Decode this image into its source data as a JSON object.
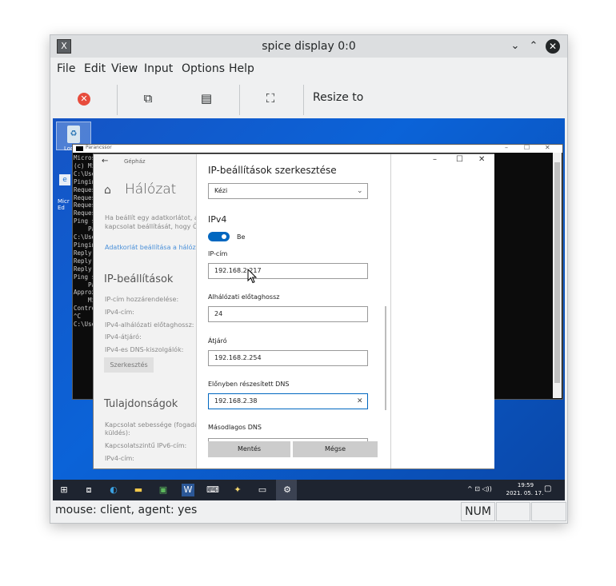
{
  "window": {
    "title": "spice display 0:0",
    "app_icon": "X"
  },
  "titlebar_controls": {
    "minimize": "⌄",
    "maximize": "⌃",
    "close": "✕"
  },
  "menubar": {
    "items": [
      "File",
      "Edit",
      "View",
      "Input",
      "Options",
      "Help"
    ]
  },
  "toolbar": {
    "resize_label": "Resize to"
  },
  "statusbar": {
    "text": "mouse: client, agent: yes",
    "num": "NUM"
  },
  "desktop": {
    "recycle_label": "Lom",
    "edge_label": "Micr\nEd"
  },
  "cmd": {
    "title": "Parancssor",
    "lines": [
      "Micros",
      "(c) Mi",
      "",
      "C:\\Use",
      "",
      "Pingin",
      "Reques",
      "Reques",
      "Reques",
      "Reques",
      "",
      "Ping s",
      "    Pa",
      "",
      "C:\\Use",
      "",
      "Pingin",
      "Reply",
      "Reply",
      "Reply",
      "",
      "Ping s",
      "    Pa",
      "Approx",
      "    Mi",
      "Contro",
      "^C",
      "C:\\Use"
    ]
  },
  "settings": {
    "breadcrumb": "Gépház",
    "heading": "Hálózat",
    "desc_line1": "Ha beállít egy adatkorlátot, a",
    "desc_line2": "kapcsolat beállítását, hogy Ön",
    "link": "Adatkorlát beállítása a hálóza",
    "ip_heading": "IP-beállítások",
    "ip_rows": [
      "IP-cím hozzárendelése:",
      "IPv4-cím:",
      "IPv4-alhálózati előtaghossz:",
      "IPv4-átjáró:",
      "IPv4-es DNS-kiszolgálók:"
    ],
    "edit_button": "Szerkesztés",
    "props_heading": "Tulajdonságok",
    "props_rows": [
      "Kapcsolat sebessége (fogadás",
      "küldés):",
      "Kapcsolatszintű IPv6-cím:",
      "IPv4-cím:"
    ]
  },
  "dialog": {
    "title": "IP-beállítások szerkesztése",
    "mode_value": "Kézi",
    "ipv4_heading": "IPv4",
    "toggle_label": "Be",
    "toggle_on": true,
    "ip_label": "IP-cím",
    "ip_value": "192.168.2.217",
    "prefix_label": "Alhálózati előtaghossz",
    "prefix_value": "24",
    "gateway_label": "Átjáró",
    "gateway_value": "192.168.2.254",
    "dns1_label": "Előnyben részesített DNS",
    "dns1_value": "192.168.2.38",
    "dns2_label": "Másodlagos DNS",
    "save_button": "Mentés",
    "cancel_button": "Mégse"
  },
  "taskbar": {
    "time": "19:59",
    "date": "2021. 05. 17.",
    "tray": "^ ⊡ ◁))"
  },
  "colors": {
    "accent": "#0067c0",
    "desktop": "#0b63d8",
    "taskbar": "#1e2430"
  }
}
